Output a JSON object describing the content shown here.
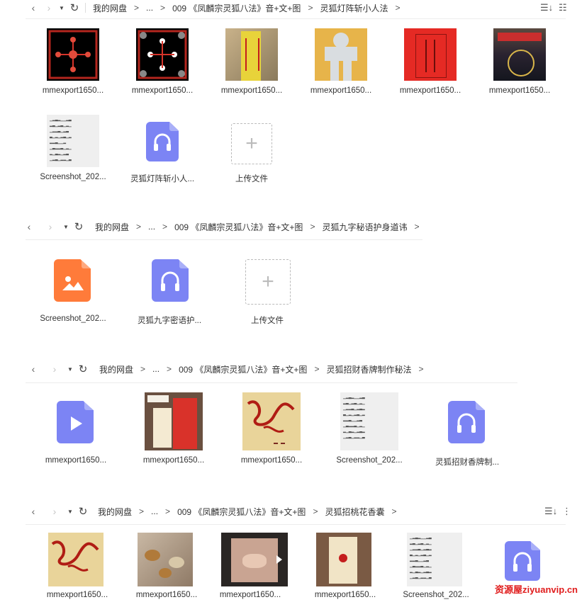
{
  "panels": [
    {
      "breadcrumb": [
        "我的网盘",
        "...",
        "009 《凤麟宗灵狐八法》音+文+图",
        "灵狐灯阵斩小人法"
      ],
      "files": [
        {
          "name": "mmexport1650...",
          "kind": "image"
        },
        {
          "name": "mmexport1650...",
          "kind": "image"
        },
        {
          "name": "mmexport1650...",
          "kind": "image"
        },
        {
          "name": "mmexport1650...",
          "kind": "image"
        },
        {
          "name": "mmexport1650...",
          "kind": "image"
        },
        {
          "name": "mmexport1650...",
          "kind": "image"
        },
        {
          "name": "Screenshot_202...",
          "kind": "doc"
        },
        {
          "name": "灵狐灯阵斩小人...",
          "kind": "audio"
        },
        {
          "name": "上传文件",
          "kind": "upload"
        }
      ]
    },
    {
      "breadcrumb": [
        "我的网盘",
        "...",
        "009 《凤麟宗灵狐八法》音+文+图",
        "灵狐九字秘语护身道讳"
      ],
      "files": [
        {
          "name": "Screenshot_202...",
          "kind": "image-icon"
        },
        {
          "name": "灵狐九字密语护...",
          "kind": "audio"
        },
        {
          "name": "上传文件",
          "kind": "upload"
        }
      ]
    },
    {
      "breadcrumb": [
        "我的网盘",
        "...",
        "009 《凤麟宗灵狐八法》音+文+图",
        "灵狐招财香牌制作秘法"
      ],
      "files": [
        {
          "name": "mmexport1650...",
          "kind": "video"
        },
        {
          "name": "mmexport1650...",
          "kind": "image"
        },
        {
          "name": "mmexport1650...",
          "kind": "image"
        },
        {
          "name": "Screenshot_202...",
          "kind": "doc"
        },
        {
          "name": "灵狐招财香牌制...",
          "kind": "audio"
        }
      ]
    },
    {
      "breadcrumb": [
        "我的网盘",
        "...",
        "009 《凤麟宗灵狐八法》音+文+图",
        "灵狐招桃花香囊"
      ],
      "files": [
        {
          "name": "mmexport1650...",
          "kind": "image"
        },
        {
          "name": "mmexport1650...",
          "kind": "image"
        },
        {
          "name": "mmexport1650...",
          "kind": "image"
        },
        {
          "name": "mmexport1650...",
          "kind": "image"
        },
        {
          "name": "Screenshot_202...",
          "kind": "doc"
        },
        {
          "name": "",
          "kind": "audio"
        }
      ]
    }
  ],
  "toolbar": {
    "sort_icon": "sort-icon",
    "more_icon": "more-icon",
    "list_icon": "list-view-icon"
  },
  "watermark": "资源屋ziyuanvip.cn",
  "colors": {
    "accent_icon": "#7c84f4",
    "image_icon": "#ff7b3a",
    "watermark": "#e01c1c"
  }
}
